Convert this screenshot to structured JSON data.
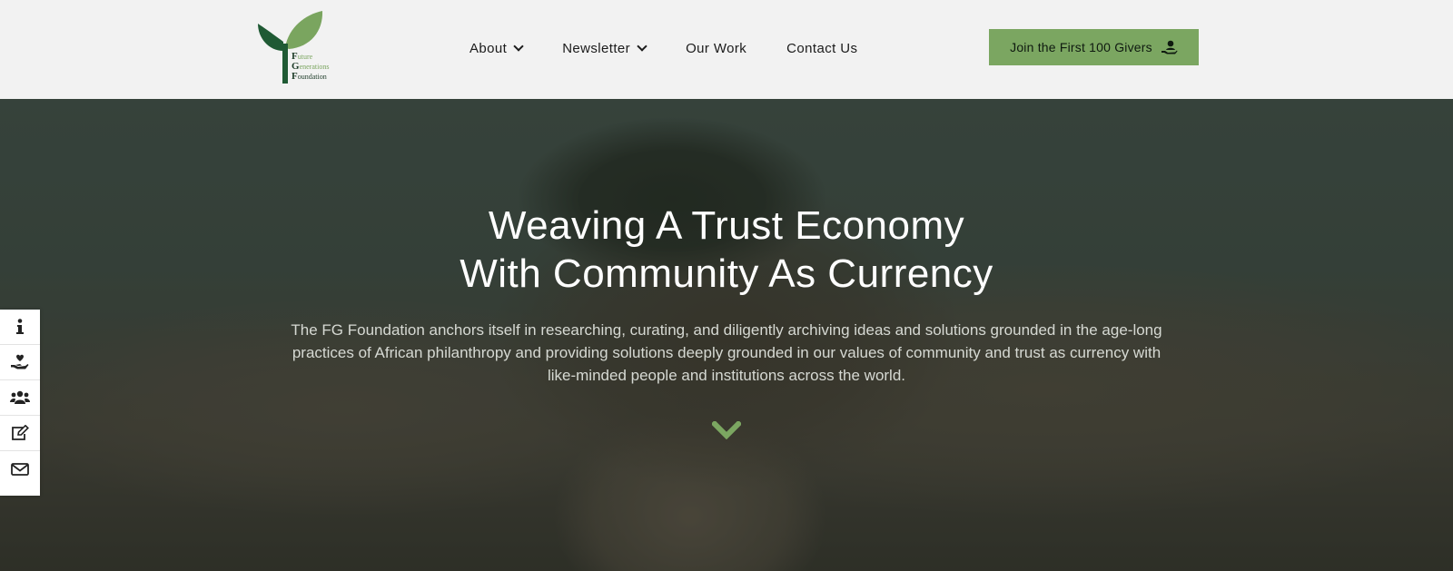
{
  "header": {
    "logo": {
      "line1_initial": "F",
      "line1_rest": "uture",
      "line2_initial": "G",
      "line2_rest": "enerations",
      "line3_initial": "F",
      "line3_rest": "oundation",
      "icon": "seedling-logo"
    },
    "nav": [
      {
        "label": "About",
        "has_dropdown": true
      },
      {
        "label": "Newsletter",
        "has_dropdown": true
      },
      {
        "label": "Our Work",
        "has_dropdown": false
      },
      {
        "label": "Contact Us",
        "has_dropdown": false
      }
    ],
    "cta": {
      "label": "Join the First 100 Givers",
      "icon": "hand-holding-user-icon"
    }
  },
  "hero": {
    "title_line1": "Weaving A Trust Economy",
    "title_line2": "With Community As Currency",
    "description": "The FG Foundation anchors itself in researching, curating, and diligently archiving ideas and solutions grounded in the age-long practices of African philanthropy and providing solutions deeply grounded in our values of community and trust as currency with like-minded people and institutions across the world.",
    "scroll_icon": "chevron-down-icon"
  },
  "sidebar": {
    "items": [
      {
        "icon": "info-icon"
      },
      {
        "icon": "hand-holding-heart-icon"
      },
      {
        "icon": "users-icon"
      },
      {
        "icon": "edit-icon"
      },
      {
        "icon": "envelope-icon"
      }
    ]
  },
  "colors": {
    "brand_green": "#7ba661",
    "dark_green": "#1f5a34",
    "header_bg": "#f2f2f2"
  }
}
